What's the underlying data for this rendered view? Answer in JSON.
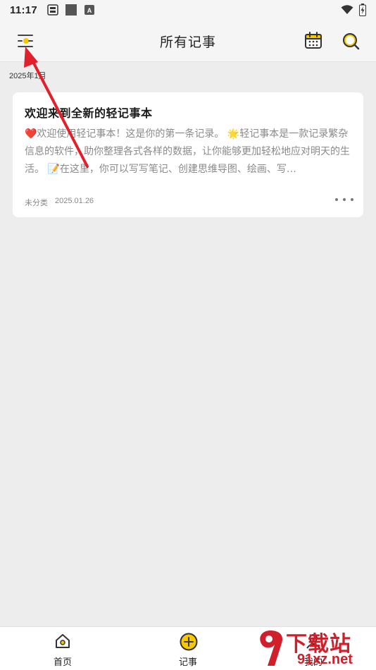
{
  "status_bar": {
    "time": "11:17",
    "icons": [
      "sim-card-icon",
      "square-icon",
      "font-a-icon",
      "wifi-icon",
      "battery-charging-icon"
    ]
  },
  "header": {
    "title": "所有记事",
    "left_icon": "menu-icon",
    "right_icons": [
      "calendar-icon",
      "search-icon"
    ]
  },
  "list": {
    "month_label": "2025年1月",
    "notes": [
      {
        "title": "欢迎来到全新的轻记事本",
        "body": "❤️欢迎使用轻记事本！这是你的第一条记录。 🌟轻记事本是一款记录繁杂信息的软件，助你整理各式各样的数据，让你能够更加轻松地应对明天的生活。 📝在这里，你可以写写笔记、创建思维导图、绘画、写…",
        "category": "未分类",
        "date": "2025.01.26",
        "more_icon": "more-horizontal-icon"
      }
    ]
  },
  "bottom_nav": {
    "items": [
      {
        "label": "首页",
        "icon": "home-icon"
      },
      {
        "label": "记事",
        "icon": "add-circle-icon"
      },
      {
        "label": "我的",
        "icon": "person-icon"
      }
    ]
  },
  "watermark": {
    "brand_top": "下载站",
    "brand_bottom": "91xz.net"
  },
  "colors": {
    "accent": "#f5c800",
    "annotation_arrow": "#e0202a",
    "background": "#ededed"
  }
}
